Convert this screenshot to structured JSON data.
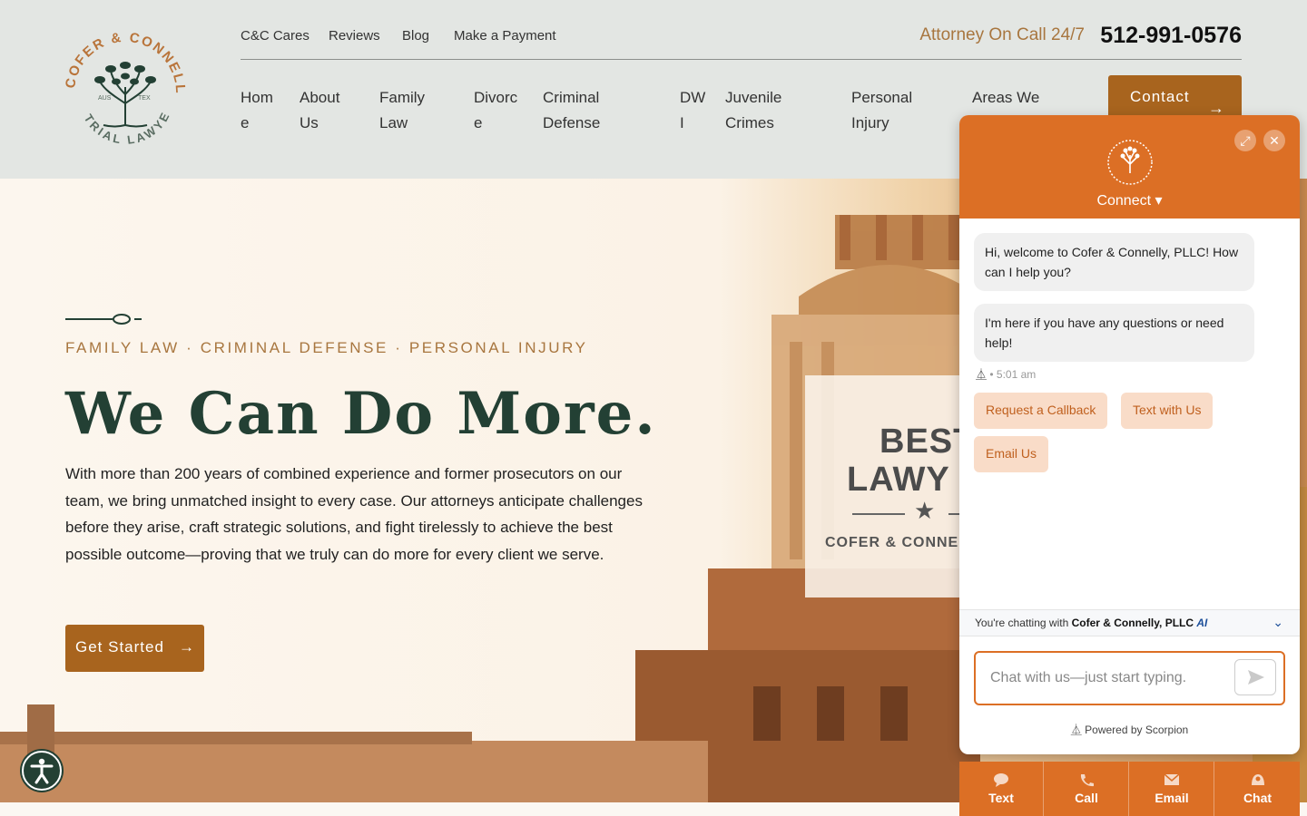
{
  "logo": {
    "top_text": "COFER & CONNELLY",
    "bottom_text": "TRIAL LAWYERS",
    "left_mark": "AUS",
    "right_mark": "TEX"
  },
  "utility_nav": {
    "items": [
      "C&C Cares",
      "Reviews",
      "Blog",
      "Make a Payment"
    ],
    "attorney_label": "Attorney On Call 24/7",
    "phone": "512-991-0576"
  },
  "main_nav": {
    "items": [
      {
        "l1": "Hom",
        "l2": "e"
      },
      {
        "l1": "About",
        "l2": "Us"
      },
      {
        "l1": "Family",
        "l2": "Law"
      },
      {
        "l1": "Divorc",
        "l2": "e"
      },
      {
        "l1": "Criminal",
        "l2": "Defense"
      },
      {
        "l1": "DW",
        "l2": "I"
      },
      {
        "l1": "Juvenile",
        "l2": "Crimes"
      },
      {
        "l1": "Personal",
        "l2": "Injury"
      },
      {
        "l1": "Areas We",
        "l2": ""
      }
    ],
    "contact_label": "Contact"
  },
  "hero": {
    "eyebrow": "FAMILY LAW · CRIMINAL DEFENSE · PERSONAL INJURY",
    "title": "We Can Do More.",
    "body": "With more than 200 years of combined experience and former prosecutors on our team, we bring unmatched insight to every case. Our attorneys anticipate challenges before they arise, craft strategic solutions, and fight tirelessly to achieve the best possible outcome—proving that we truly can do more for every client we serve.",
    "cta_label": "Get Started",
    "badge": {
      "line1": "BEST",
      "line2": "LAWY",
      "line3": "COFER & CONNEL"
    }
  },
  "chat": {
    "connect_label": "Connect ▾",
    "messages": [
      "Hi, welcome to Cofer & Connelly, PLLC! How can I help you?",
      "I'm here if you have any questions or need help!"
    ],
    "time": "• 5:01 am",
    "quick_replies": [
      "Request a Callback",
      "Text with Us",
      "Email Us"
    ],
    "chatting_prefix": "You're chatting with",
    "chatting_with": "Cofer & Connelly, PLLC",
    "ai_label": "AI",
    "input_placeholder": "Chat with us—just start typing.",
    "powered_by": "Powered by Scorpion"
  },
  "bottom_bar": {
    "items": [
      "Text",
      "Call",
      "Email",
      "Chat"
    ]
  },
  "colors": {
    "accent": "#a8641e",
    "brand_green": "#234034",
    "chat_orange": "#dc6f25",
    "gold_text": "#a8763f",
    "header_bg": "#e3e6e3"
  }
}
